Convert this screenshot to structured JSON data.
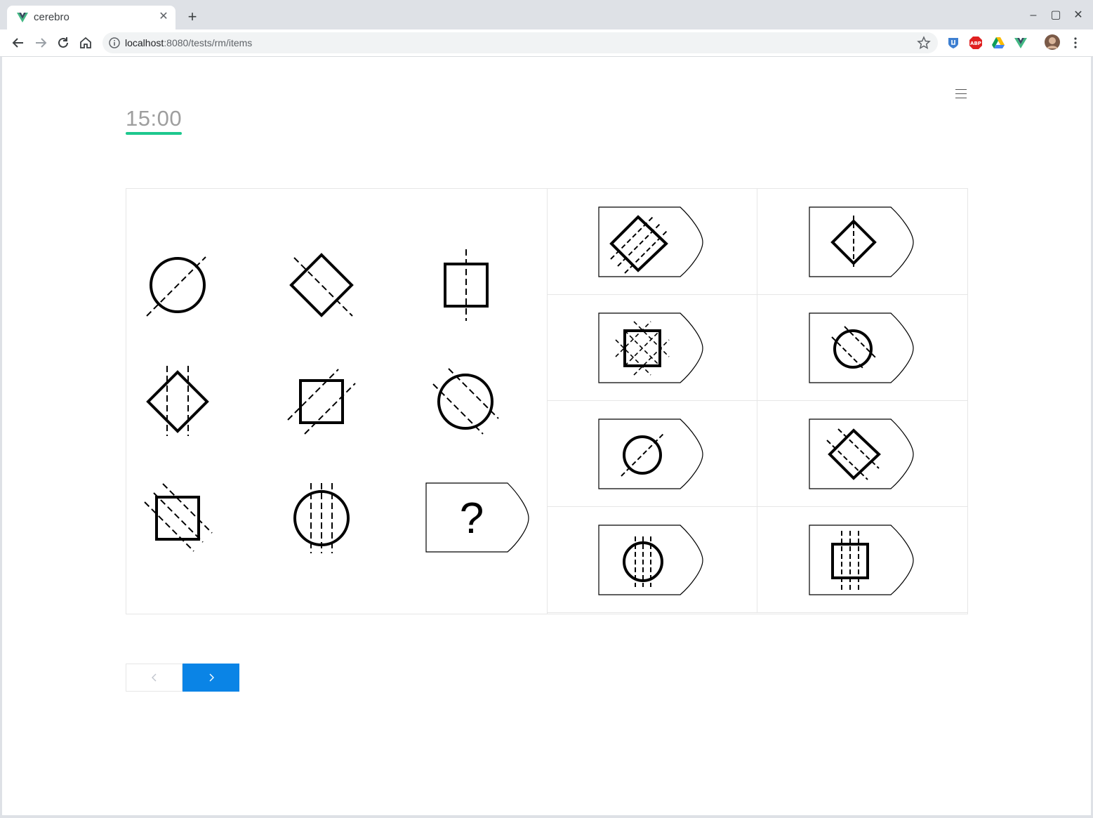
{
  "browser": {
    "tab_title": "cerebro",
    "url_host": "localhost",
    "url_rest": ":8080/tests/rm/items",
    "extensions": [
      "shield-extension-icon",
      "abp-extension-icon",
      "drive-extension-icon",
      "vue-extension-icon",
      "profile-avatar"
    ]
  },
  "timer": {
    "value": "15:00",
    "accent_color": "#1ec88e"
  },
  "question": {
    "mark": "?",
    "matrix": [
      [
        "circle-one-diagonal-line",
        "diamond-one-diagonal-line",
        "square-one-vertical-line"
      ],
      [
        "diamond-two-vertical-lines",
        "square-two-diagonal-lines",
        "circle-two-diagonal-lines"
      ],
      [
        "square-three-diagonal-lines",
        "circle-three-vertical-lines",
        "missing"
      ]
    ]
  },
  "answers": [
    "diamond-three-diagonal-lines",
    "diamond-one-vertical-line",
    "square-crossed-diagonal-lines",
    "circle-two-diagonal-lines",
    "circle-one-diagonal-line",
    "diamond-two-diagonal-lines",
    "circle-three-vertical-lines",
    "square-three-vertical-lines"
  ],
  "pagination": {
    "prev_icon": "chevron-left-icon",
    "next_icon": "chevron-right-icon",
    "next_color": "#0a84e6"
  }
}
